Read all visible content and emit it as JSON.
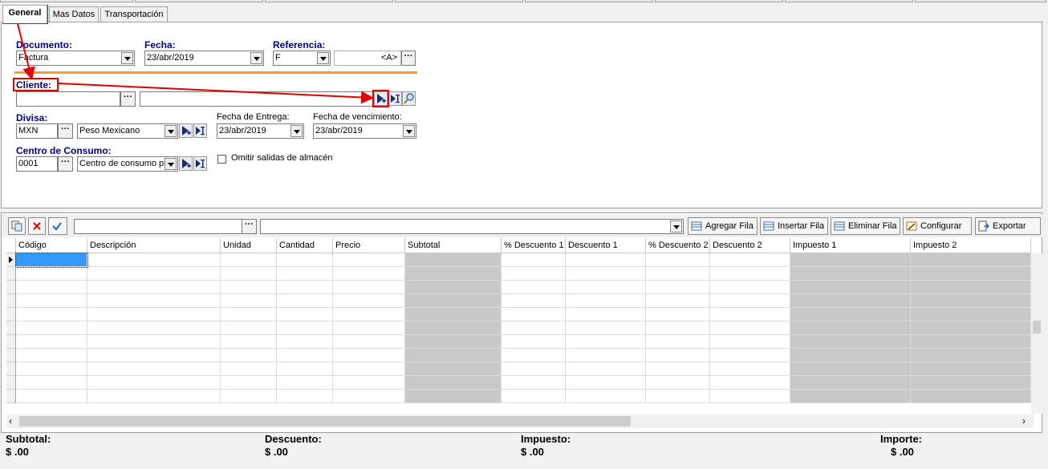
{
  "tabs": [
    {
      "label": "General"
    },
    {
      "label": "Mas Datos"
    },
    {
      "label": "Transportación"
    }
  ],
  "form": {
    "documento": {
      "label": "Documento:",
      "value": "Factura"
    },
    "fecha": {
      "label": "Fecha:",
      "value": "23/abr/2019"
    },
    "referencia": {
      "label": "Referencia:",
      "value": "F",
      "suffix": "<A>"
    },
    "cliente": {
      "label": "Cliente:",
      "code": "",
      "name": ""
    },
    "divisa": {
      "label": "Divisa:",
      "code": "MXN",
      "name": "Peso Mexicano"
    },
    "fecha_entrega": {
      "label": "Fecha de Entrega:",
      "value": "23/abr/2019"
    },
    "fecha_vencimiento": {
      "label": "Fecha de vencimiento:",
      "value": "23/abr/2019"
    },
    "centro": {
      "label": "Centro de Consumo:",
      "code": "0001",
      "name": "Centro de consumo pr"
    },
    "omitir": {
      "label": "Omitir salidas de almacén",
      "checked": false
    }
  },
  "toolbar": {
    "search_value": "",
    "agregar": "Agregar Fila",
    "insertar": "Insertar Fila",
    "eliminar": "Eliminar Fila",
    "configurar": "Configurar",
    "exportar": "Exportar"
  },
  "grid": {
    "columns": [
      "Código",
      "Descripción",
      "Unidad",
      "Cantidad",
      "Precio",
      "Subtotal",
      "% Descuento 1",
      "Descuento 1",
      "% Descuento 2",
      "Descuento 2",
      "Impuesto 1",
      "Impuesto 2"
    ],
    "row_count": 11
  },
  "totals": {
    "subtotal": {
      "label": "Subtotal:",
      "value": "$ .00"
    },
    "descuento": {
      "label": "Descuento:",
      "value": "$ .00"
    },
    "impuesto": {
      "label": "Impuesto:",
      "value": "$ .00"
    },
    "importe": {
      "label": "Importe:",
      "value": "$ .00"
    }
  },
  "colors": {
    "annotation": "#e00000",
    "label_blue": "#000080",
    "separator": "#f0a030"
  }
}
